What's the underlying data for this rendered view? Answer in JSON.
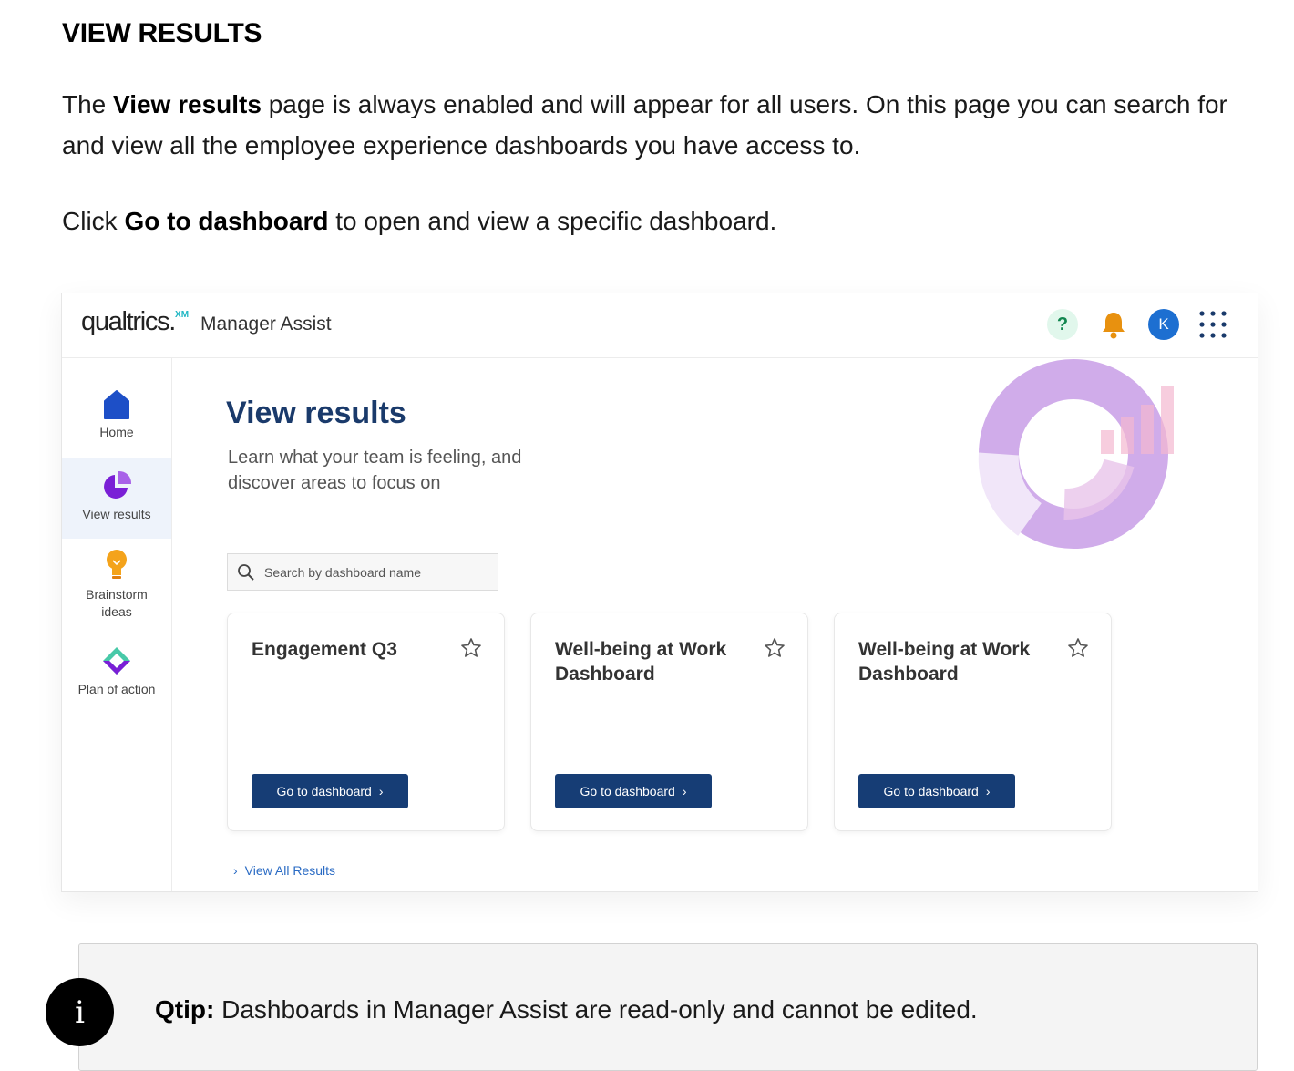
{
  "doc": {
    "heading": "VIEW RESULTS",
    "p1_pre": "The ",
    "p1_bold": "View results",
    "p1_post": " page is always enabled and will appear for all users. On this page you can search for and view all the employee experience dashboards you have access to.",
    "p2_pre": "Click ",
    "p2_bold": "Go to dashboard",
    "p2_post": " to open and view a specific dashboard."
  },
  "app": {
    "logo": "qualtrics.",
    "logo_mark": "XM",
    "title": "Manager Assist",
    "help": "?",
    "avatar": "K",
    "icons": {
      "help": "question-icon",
      "notifications": "bell-icon",
      "apps": "apps-grid-icon"
    },
    "colors": {
      "primary": "#163d75",
      "title": "#1a3a6b",
      "accent_purple": "#7a1fd6",
      "link": "#2a6bc4"
    }
  },
  "nav": {
    "home": "Home",
    "view_results": "View results",
    "brainstorm_1": "Brainstorm",
    "brainstorm_2": "ideas",
    "plan": "Plan of action",
    "active": "View results"
  },
  "main": {
    "title": "View results",
    "subtitle": "Learn what your team is feeling, and discover areas to focus on",
    "search_placeholder": "Search by dashboard name",
    "cards": [
      {
        "title": "Engagement Q3",
        "button": "Go to dashboard"
      },
      {
        "title": "Well-being at Work Dashboard",
        "button": "Go to dashboard"
      },
      {
        "title": "Well-being at Work Dashboard",
        "button": "Go to dashboard"
      }
    ],
    "view_all": "View All Results"
  },
  "qtip": {
    "badge": "i",
    "label": "Qtip:",
    "text": " Dashboards in Manager Assist are read-only and cannot be edited."
  }
}
